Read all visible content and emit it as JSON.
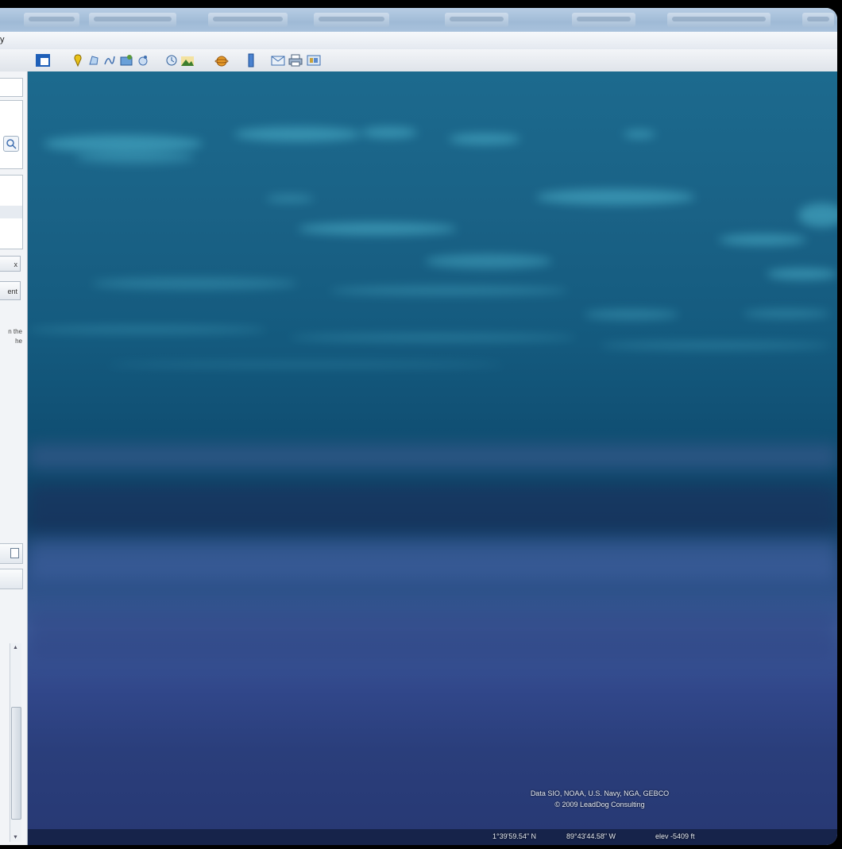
{
  "menubar": {
    "tail_label": "y"
  },
  "toolbar": {
    "items": [
      "sidebar-toggle-icon",
      "placemark-icon",
      "polygon-icon",
      "path-icon",
      "overlay-icon",
      "record-tour-icon",
      "historical-imagery-icon",
      "sun-icon",
      "planets-icon",
      "ruler-icon",
      "email-icon",
      "print-icon",
      "view-in-maps-icon"
    ]
  },
  "sidebar": {
    "close_label": "x",
    "button_label": "ent",
    "help_line1": "n the",
    "help_line2": "he"
  },
  "view": {
    "attribution_line1": "Data SIO, NOAA, U.S. Navy, NGA, GEBCO",
    "attribution_line2": "© 2009 LeadDog Consulting",
    "latitude": "1°39'59.54\" N",
    "longitude": "89°43'44.58\" W",
    "elevation": "elev -5409 ft"
  }
}
